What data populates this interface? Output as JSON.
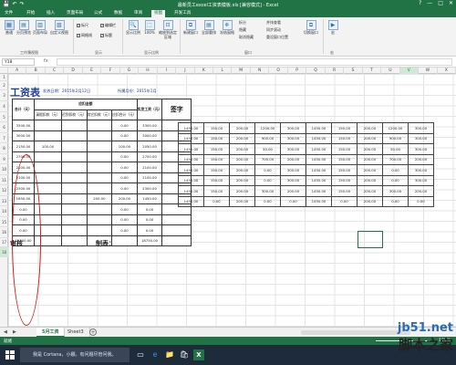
{
  "window": {
    "title": "最新员工excel工资表模板.xls [兼容模式] - Excel",
    "qat": [
      "💾",
      "↶",
      "↷"
    ],
    "controls": [
      "?",
      "—",
      "□",
      "✕"
    ]
  },
  "tabs": [
    "文件",
    "开始",
    "插入",
    "页面布局",
    "公式",
    "数据",
    "审阅",
    "视图",
    "开发工具"
  ],
  "active_tab": "视图",
  "ribbon": {
    "views": [
      {
        "label": "普通",
        "selected": true
      },
      {
        "label": "分页预览",
        "selected": false
      },
      {
        "label": "页面布局",
        "selected": false
      },
      {
        "label": "自定义视图",
        "selected": false
      }
    ],
    "views_group": "工作簿视图",
    "show_checks": [
      {
        "label": "标尺",
        "checked": true
      },
      {
        "label": "编辑栏",
        "checked": true
      },
      {
        "label": "网格线",
        "checked": true
      },
      {
        "label": "标题",
        "checked": true
      }
    ],
    "show_group": "显示",
    "zoom_buttons": [
      "显示比例",
      "100%",
      "缩放到选定区域"
    ],
    "zoom_group": "显示比例",
    "window_buttons": [
      "新建窗口",
      "全部重排",
      "冻结窗格"
    ],
    "window_small": [
      "拆分",
      "隐藏",
      "取消隐藏",
      "并排查看",
      "同步滚动",
      "重设窗口位置"
    ],
    "switch_button": "切换窗口",
    "window_group": "窗口",
    "macro_button": "宏",
    "macro_group": "宏"
  },
  "formula_bar": {
    "name_box": "Y18",
    "fx": "fx",
    "content": ""
  },
  "columns": [
    "A",
    "B",
    "C",
    "D",
    "E",
    "F",
    "G",
    "H",
    "I",
    "J",
    "K",
    "L",
    "M",
    "N",
    "O",
    "P",
    "Q",
    "R",
    "S",
    "T",
    "U",
    "V",
    "W",
    "X"
  ],
  "selected_column": "V",
  "rows": [
    "1",
    "2",
    "3",
    "4",
    "5",
    "6",
    "7",
    "8",
    "9",
    "10",
    "11",
    "12",
    "13",
    "14",
    "15",
    "16",
    "17",
    "18"
  ],
  "selected_row": "18",
  "sheet": {
    "title": "工资表",
    "meta_left": "发放日期：2015年2月12日",
    "meta_mid": "所属月份：2015年1月",
    "table_headers": {
      "total": "合计（元）",
      "deduction_group": "应扣金额",
      "cols": [
        "请假扣款（元）",
        "迟到扣款（元）",
        "其它扣款（元）",
        "应扣合计（元）"
      ],
      "net": "实发工资（元）",
      "sign": "签字"
    },
    "table_rows": [
      {
        "total": "3300.00",
        "leave": "",
        "late": "",
        "other": "",
        "ded": "0.00",
        "net": "3300.00"
      },
      {
        "total": "3000.00",
        "leave": "",
        "late": "",
        "other": "",
        "ded": "0.00",
        "net": "3000.00"
      },
      {
        "total": "2150.00",
        "leave": "100.00",
        "late": "",
        "other": "",
        "ded": "100.00",
        "net": "2050.00"
      },
      {
        "total": "2700.00",
        "leave": "",
        "late": "",
        "other": "",
        "ded": "0.00",
        "net": "2700.00"
      },
      {
        "total": "2100.00",
        "leave": "",
        "late": "",
        "other": "",
        "ded": "0.00",
        "net": "2100.00"
      },
      {
        "total": "2100.00",
        "leave": "",
        "late": "",
        "other": "",
        "ded": "0.00",
        "net": "2100.00"
      },
      {
        "total": "2300.00",
        "leave": "",
        "late": "",
        "other": "",
        "ded": "0.00",
        "net": "2300.00"
      },
      {
        "total": "1650.00",
        "leave": "",
        "late": "",
        "other": "200.00",
        "ded": "200.00",
        "net": "1450.00"
      },
      {
        "total": "0.00",
        "leave": "",
        "late": "",
        "other": "",
        "ded": "0.00",
        "net": "0.00"
      },
      {
        "total": "0.00",
        "leave": "",
        "late": "",
        "other": "",
        "ded": "0.00",
        "net": "0.00"
      },
      {
        "total": "0.00",
        "leave": "",
        "late": "",
        "other": "",
        "ded": "0.00",
        "net": "0.00"
      }
    ],
    "sum_row": {
      "total": "19300.00",
      "net": "18750.00"
    },
    "ext_rows": [
      [
        "1450.00",
        "150.00",
        "200.00",
        "1200.00",
        "300.00",
        "1450.00",
        "150.00",
        "200.00",
        "1200.00",
        "300.00"
      ],
      [
        "1450.00",
        "150.00",
        "200.00",
        "900.00",
        "300.00",
        "1450.00",
        "150.00",
        "200.00",
        "900.00",
        "300.00"
      ],
      [
        "1450.00",
        "150.00",
        "200.00",
        "50.00",
        "300.00",
        "1450.00",
        "150.00",
        "200.00",
        "50.00",
        "300.00"
      ],
      [
        "1450.00",
        "150.00",
        "200.00",
        "700.00",
        "200.00",
        "1450.00",
        "150.00",
        "200.00",
        "700.00",
        "200.00"
      ],
      [
        "1450.00",
        "150.00",
        "200.00",
        "0.00",
        "300.00",
        "1450.00",
        "150.00",
        "200.00",
        "0.00",
        "300.00"
      ],
      [
        "1450.00",
        "150.00",
        "200.00",
        "0.00",
        "300.00",
        "1450.00",
        "150.00",
        "200.00",
        "0.00",
        "300.00"
      ],
      [
        "1450.00",
        "150.00",
        "200.00",
        "300.00",
        "200.00",
        "1450.00",
        "150.00",
        "200.00",
        "300.00",
        "200.00"
      ],
      [
        "1450.00",
        "0.00",
        "200.00",
        "0.00",
        "0.00",
        "1450.00",
        "0.00",
        "200.00",
        "0.00",
        "0.00"
      ]
    ],
    "bottom_left": "制表：",
    "bottom_cut": "审核"
  },
  "sheet_tabs": [
    "5月工资",
    "Sheet3"
  ],
  "active_sheet": "5月工资",
  "status": {
    "ready": "就绪",
    "zoom": "100%"
  },
  "taskbar": {
    "cortana": "我是 Cortana，小娜。有问题尽管问我。",
    "icons": [
      "▭",
      "e",
      "📁",
      "🛍",
      "X"
    ]
  },
  "watermark": {
    "line1": "jb51.net",
    "line2": "脚本之家"
  },
  "colors": {
    "excel_green": "#217346",
    "highlight_red": "#d01818",
    "title_blue": "#1f3f8f"
  }
}
